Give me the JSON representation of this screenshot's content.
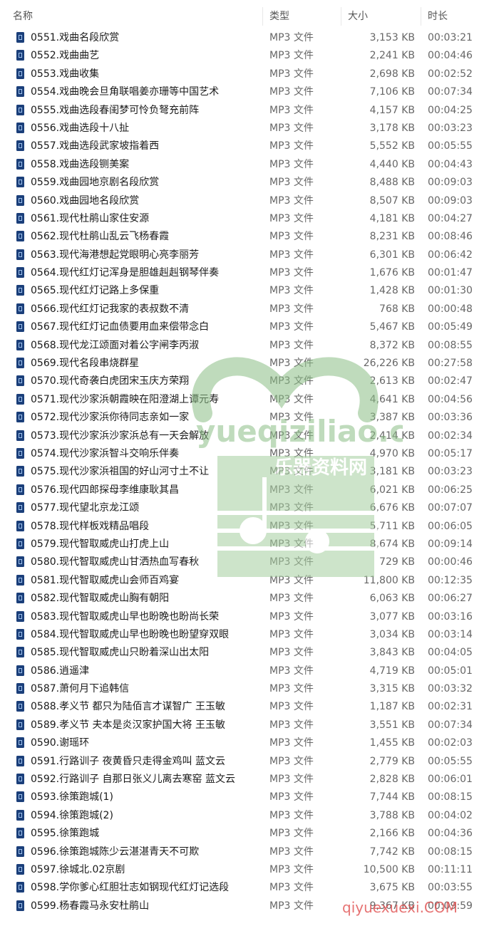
{
  "columns": {
    "name": "名称",
    "type": "类型",
    "size": "大小",
    "duration": "时长"
  },
  "icon": "audio-file-icon",
  "rows": [
    {
      "name": "0551.戏曲名段欣赏",
      "type": "MP3 文件",
      "size": "3,153 KB",
      "duration": "00:03:21"
    },
    {
      "name": "0552.戏曲曲艺",
      "type": "MP3 文件",
      "size": "2,241 KB",
      "duration": "00:04:46"
    },
    {
      "name": "0553.戏曲收集",
      "type": "MP3 文件",
      "size": "2,698 KB",
      "duration": "00:02:52"
    },
    {
      "name": "0554.戏曲晚会旦角联唱姜亦珊等中国艺术",
      "type": "MP3 文件",
      "size": "7,106 KB",
      "duration": "00:07:34"
    },
    {
      "name": "0555.戏曲选段春闺梦可怜负弩充前阵",
      "type": "MP3 文件",
      "size": "4,157 KB",
      "duration": "00:04:25"
    },
    {
      "name": "0556.戏曲选段十八扯",
      "type": "MP3 文件",
      "size": "3,178 KB",
      "duration": "00:03:23"
    },
    {
      "name": "0557.戏曲选段武家坡指着西",
      "type": "MP3 文件",
      "size": "5,552 KB",
      "duration": "00:05:55"
    },
    {
      "name": "0558.戏曲选段铡美案",
      "type": "MP3 文件",
      "size": "4,440 KB",
      "duration": "00:04:43"
    },
    {
      "name": "0559.戏曲园地京剧名段欣赏",
      "type": "MP3 文件",
      "size": "8,488 KB",
      "duration": "00:09:03"
    },
    {
      "name": "0560.戏曲园地名段欣赏",
      "type": "MP3 文件",
      "size": "8,507 KB",
      "duration": "00:09:03"
    },
    {
      "name": "0561.现代杜鹃山家住安源",
      "type": "MP3 文件",
      "size": "4,181 KB",
      "duration": "00:04:27"
    },
    {
      "name": "0562.现代杜鹃山乱云飞杨春霞",
      "type": "MP3 文件",
      "size": "8,231 KB",
      "duration": "00:08:46"
    },
    {
      "name": "0563.现代海港想起党眼明心亮李丽芳",
      "type": "MP3 文件",
      "size": "6,301 KB",
      "duration": "00:06:42"
    },
    {
      "name": "0564.现代红灯记浑身是胆雄赳赳钢琴伴奏",
      "type": "MP3 文件",
      "size": "1,676 KB",
      "duration": "00:01:47"
    },
    {
      "name": "0565.现代红灯记路上多保重",
      "type": "MP3 文件",
      "size": "1,428 KB",
      "duration": "00:01:30"
    },
    {
      "name": "0566.现代红灯记我家的表叔数不清",
      "type": "MP3 文件",
      "size": "768 KB",
      "duration": "00:00:48"
    },
    {
      "name": "0567.现代红灯记血债要用血来偿带念白",
      "type": "MP3 文件",
      "size": "5,467 KB",
      "duration": "00:05:49"
    },
    {
      "name": "0568.现代龙江颂面对着公字闸李丙淑",
      "type": "MP3 文件",
      "size": "8,372 KB",
      "duration": "00:08:55"
    },
    {
      "name": "0569.现代名段串烧群星",
      "type": "MP3 文件",
      "size": "26,226 KB",
      "duration": "00:27:58"
    },
    {
      "name": "0570.现代奇袭白虎团宋玉庆方荣翔",
      "type": "MP3 文件",
      "size": "2,613 KB",
      "duration": "00:02:47"
    },
    {
      "name": "0571.现代沙家浜朝霞映在阳澄湖上谭元寿",
      "type": "MP3 文件",
      "size": "4,641 KB",
      "duration": "00:04:56"
    },
    {
      "name": "0572.现代沙家浜你待同志亲如一家",
      "type": "MP3 文件",
      "size": "3,387 KB",
      "duration": "00:03:36"
    },
    {
      "name": "0573.现代沙家浜沙家浜总有一天会解放",
      "type": "MP3 文件",
      "size": "2,414 KB",
      "duration": "00:02:34"
    },
    {
      "name": "0574.现代沙家浜智斗交响乐伴奏",
      "type": "MP3 文件",
      "size": "4,970 KB",
      "duration": "00:05:17"
    },
    {
      "name": "0575.现代沙家浜祖国的好山河寸土不让",
      "type": "MP3 文件",
      "size": "3,181 KB",
      "duration": "00:03:23"
    },
    {
      "name": "0576.现代四郎探母李维康耿其昌",
      "type": "MP3 文件",
      "size": "6,021 KB",
      "duration": "00:06:25"
    },
    {
      "name": "0577.现代望北京龙江颂",
      "type": "MP3 文件",
      "size": "6,676 KB",
      "duration": "00:07:07"
    },
    {
      "name": "0578.现代样板戏精品唱段",
      "type": "MP3 文件",
      "size": "5,711 KB",
      "duration": "00:06:05"
    },
    {
      "name": "0579.现代智取威虎山打虎上山",
      "type": "MP3 文件",
      "size": "8,674 KB",
      "duration": "00:09:14"
    },
    {
      "name": "0580.现代智取威虎山甘洒热血写春秋",
      "type": "MP3 文件",
      "size": "729 KB",
      "duration": "00:00:46"
    },
    {
      "name": "0581.现代智取威虎山会师百鸡宴",
      "type": "MP3 文件",
      "size": "11,800 KB",
      "duration": "00:12:35"
    },
    {
      "name": "0582.现代智取威虎山胸有朝阳",
      "type": "MP3 文件",
      "size": "6,063 KB",
      "duration": "00:06:27"
    },
    {
      "name": "0583.现代智取威虎山早也盼晚也盼尚长荣",
      "type": "MP3 文件",
      "size": "3,077 KB",
      "duration": "00:03:16"
    },
    {
      "name": "0584.现代智取威虎山早也盼晚也盼望穿双眼",
      "type": "MP3 文件",
      "size": "3,034 KB",
      "duration": "00:03:14"
    },
    {
      "name": "0585.现代智取威虎山只盼着深山出太阳",
      "type": "MP3 文件",
      "size": "3,843 KB",
      "duration": "00:04:05"
    },
    {
      "name": "0586.逍遥津",
      "type": "MP3 文件",
      "size": "4,719 KB",
      "duration": "00:05:01"
    },
    {
      "name": "0587.萧何月下追韩信",
      "type": "MP3 文件",
      "size": "3,315 KB",
      "duration": "00:03:32"
    },
    {
      "name": "0588.孝义节 都只为陆佰言才谋智广 王玉敏",
      "type": "MP3 文件",
      "size": "1,187 KB",
      "duration": "00:02:31"
    },
    {
      "name": "0589.孝义节 夫本是炎汉家护国大将 王玉敏",
      "type": "MP3 文件",
      "size": "3,551 KB",
      "duration": "00:07:34"
    },
    {
      "name": "0590.谢瑶环",
      "type": "MP3 文件",
      "size": "1,455 KB",
      "duration": "00:02:03"
    },
    {
      "name": "0591.行路训子 夜黄昏只走得金鸡叫 蓝文云",
      "type": "MP3 文件",
      "size": "2,779 KB",
      "duration": "00:05:55"
    },
    {
      "name": "0592.行路训子 自那日张义儿离去寒窑 蓝文云",
      "type": "MP3 文件",
      "size": "2,828 KB",
      "duration": "00:06:01"
    },
    {
      "name": "0593.徐策跑城(1)",
      "type": "MP3 文件",
      "size": "7,744 KB",
      "duration": "00:08:15"
    },
    {
      "name": "0594.徐策跑城(2)",
      "type": "MP3 文件",
      "size": "3,788 KB",
      "duration": "00:04:02"
    },
    {
      "name": "0595.徐策跑城",
      "type": "MP3 文件",
      "size": "2,166 KB",
      "duration": "00:04:36"
    },
    {
      "name": "0596.徐策跑城陈少云湛湛青天不可欺",
      "type": "MP3 文件",
      "size": "7,742 KB",
      "duration": "00:08:15"
    },
    {
      "name": "0597.徐城北.02京剧",
      "type": "MP3 文件",
      "size": "10,500 KB",
      "duration": "00:11:11"
    },
    {
      "name": "0598.学你爹心红胆壮志如钢现代红灯记选段",
      "type": "MP3 文件",
      "size": "3,675 KB",
      "duration": "00:03:55"
    },
    {
      "name": "0599.杨春霞马永安杜鹃山",
      "type": "MP3 文件",
      "size": "9,367 KB",
      "duration": "00:09:59"
    }
  ],
  "watermarks": {
    "center_text": "yueqiziliao.com",
    "center_cn": "乐器资料网",
    "corner_text": "qiyuexuexi.COM"
  },
  "colors": {
    "icon": "#1b3f7a",
    "watermark_green": "#7fb07a",
    "watermark_red": "#e05050"
  }
}
